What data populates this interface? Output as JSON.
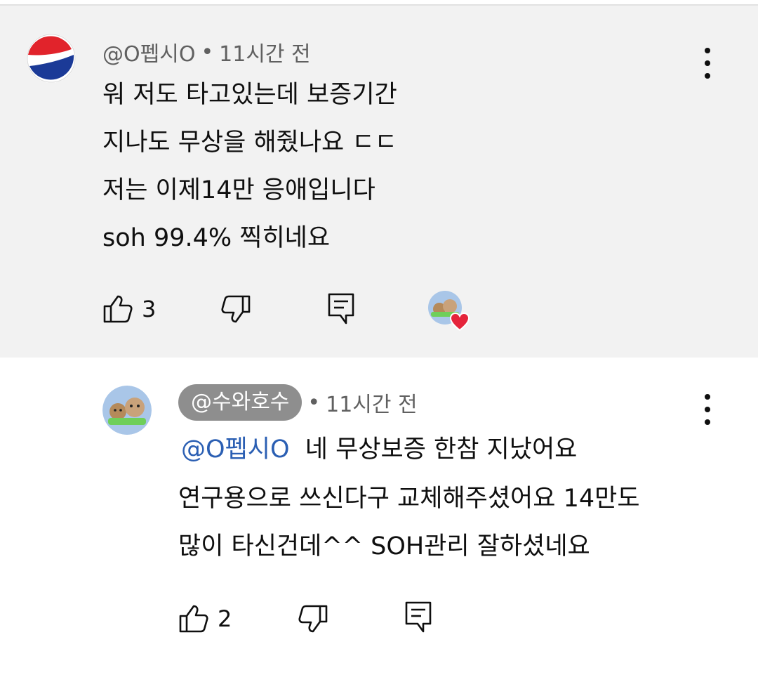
{
  "comment1": {
    "author": "@O펩시O",
    "time": "11시간 전",
    "separator": "•",
    "lines": [
      "워 저도 타고있는데 보증기간",
      "지나도 무상을 해줬나요 ㄷㄷ",
      "저는 이제14만 응애입니다",
      "soh 99.4% 찍히네요"
    ],
    "like_count": "3",
    "avatar_icon": "pepsi-logo",
    "creator_heart_icon": "heart-icon"
  },
  "comment2": {
    "author": "@수와호수",
    "time": "11시간 전",
    "separator": "•",
    "mention": "@O펩시O",
    "line1_text": "네 무상보증 한참 지났어요",
    "lines": [
      "연구용으로 쓰신다구 교체해주셨어요 14만도",
      "많이 타신건데^^ SOH관리 잘하셨네요"
    ],
    "like_count": "2",
    "avatar_icon": "cat-avatar"
  },
  "colors": {
    "highlight_bg": "#f2f2f2",
    "mention": "#2b5fb3",
    "chip_bg": "#8e8e8e",
    "heart": "#e5243b"
  }
}
